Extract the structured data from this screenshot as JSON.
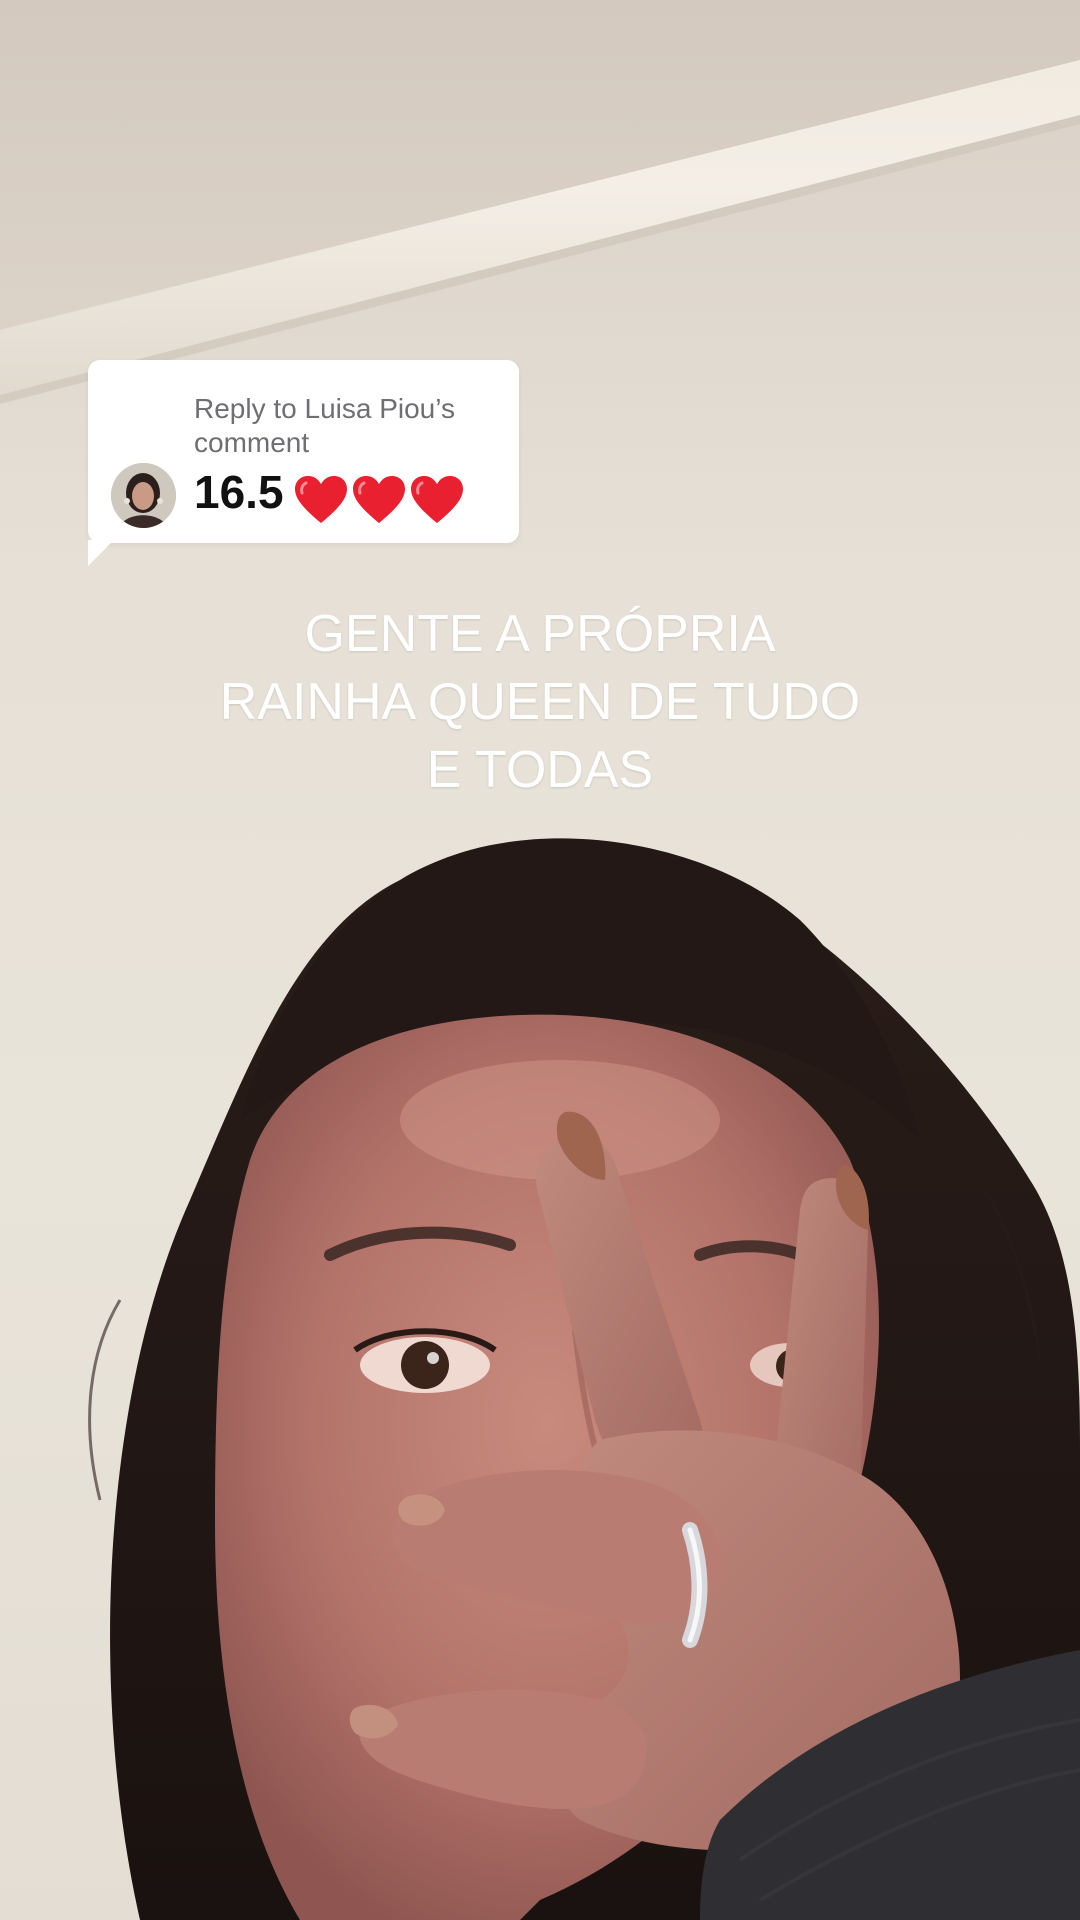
{
  "reply": {
    "header": "Reply to Luisa Piou’s comment",
    "text": "16.5",
    "hearts": 3,
    "heart_color": "#e8202f"
  },
  "caption": {
    "lines": [
      "GENTE A PRÓPRIA",
      "RAINHA QUEEN DE TUDO",
      "E TODAS"
    ]
  },
  "colors": {
    "wall": "#e7e1d7",
    "ceiling": "#d6ccc2",
    "bubble": "#ffffff",
    "header_text": "#6e6e73",
    "caption_text": "#ffffff"
  }
}
